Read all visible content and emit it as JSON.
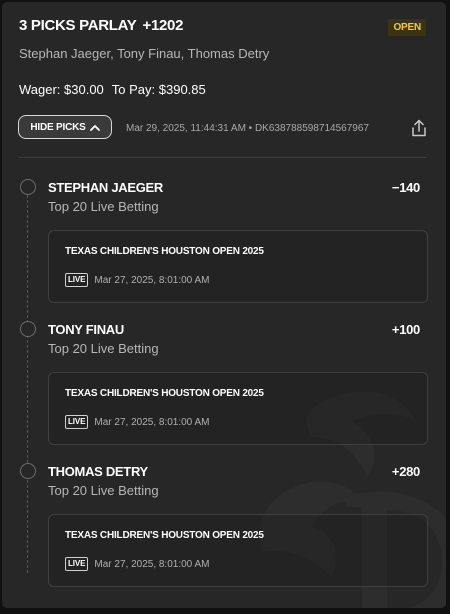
{
  "header": {
    "title": "3 PICKS PARLAY",
    "odds": "+1202",
    "status": "OPEN",
    "subtitle": "Stephan Jaeger, Tony Finau, Thomas Detry",
    "wager": "Wager: $30.00",
    "to_pay": "To Pay: $390.85"
  },
  "toolbar": {
    "hide_picks_label": "HIDE PICKS",
    "meta": "Mar 29, 2025, 11:44:31 AM • DK638788598714567967"
  },
  "picks": [
    {
      "name": "STEPHAN JAEGER",
      "market": "Top 20 Live Betting",
      "odds": "−140",
      "event": "TEXAS CHILDREN'S HOUSTON OPEN 2025",
      "live": "LIVE",
      "date": "Mar 27, 2025, 8:01:00 AM"
    },
    {
      "name": "TONY FINAU",
      "market": "Top 20 Live Betting",
      "odds": "+100",
      "event": "TEXAS CHILDREN'S HOUSTON OPEN 2025",
      "live": "LIVE",
      "date": "Mar 27, 2025, 8:01:00 AM"
    },
    {
      "name": "THOMAS DETRY",
      "market": "Top 20 Live Betting",
      "odds": "+280",
      "event": "TEXAS CHILDREN'S HOUSTON OPEN 2025",
      "live": "LIVE",
      "date": "Mar 27, 2025, 8:01:00 AM"
    }
  ],
  "colors": {
    "background": "#272727",
    "status_badge_bg": "#3b3413",
    "status_badge_text": "#f6c744"
  },
  "icons": [
    "chevron-up-icon",
    "share-icon",
    "timeline-dot-icon",
    "brand-watermark"
  ]
}
